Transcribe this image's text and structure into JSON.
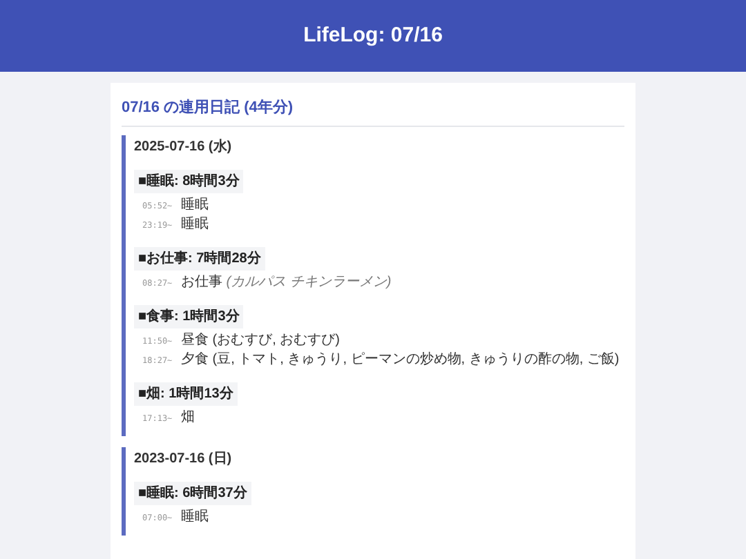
{
  "header": {
    "title": "LifeLog: 07/16"
  },
  "diary": {
    "title": "07/16 の連用日記 (4年分)",
    "days": [
      {
        "date": "2025-07-16 (水)",
        "categories": [
          {
            "label": "■睡眠: 8時間3分",
            "entries": [
              {
                "time": "05:52~",
                "text": "睡眠"
              },
              {
                "time": "23:19~",
                "text": "睡眠"
              }
            ]
          },
          {
            "label": "■お仕事: 7時間28分",
            "entries": [
              {
                "time": "08:27~",
                "text": "お仕事",
                "note": "(カルパス チキンラーメン)"
              }
            ]
          },
          {
            "label": "■食事: 1時間3分",
            "entries": [
              {
                "time": "11:50~",
                "text": "昼食 (おむすび, おむすび)"
              },
              {
                "time": "18:27~",
                "text": "夕食 (豆, トマト, きゅうり, ピーマンの炒め物, きゅうりの酢の物, ご飯)"
              }
            ]
          },
          {
            "label": "■畑: 1時間13分",
            "entries": [
              {
                "time": "17:13~",
                "text": "畑"
              }
            ]
          }
        ]
      },
      {
        "date": "2023-07-16 (日)",
        "categories": [
          {
            "label": "■睡眠: 6時間37分",
            "entries": [
              {
                "time": "07:00~",
                "text": "睡眠"
              }
            ]
          }
        ]
      }
    ]
  }
}
